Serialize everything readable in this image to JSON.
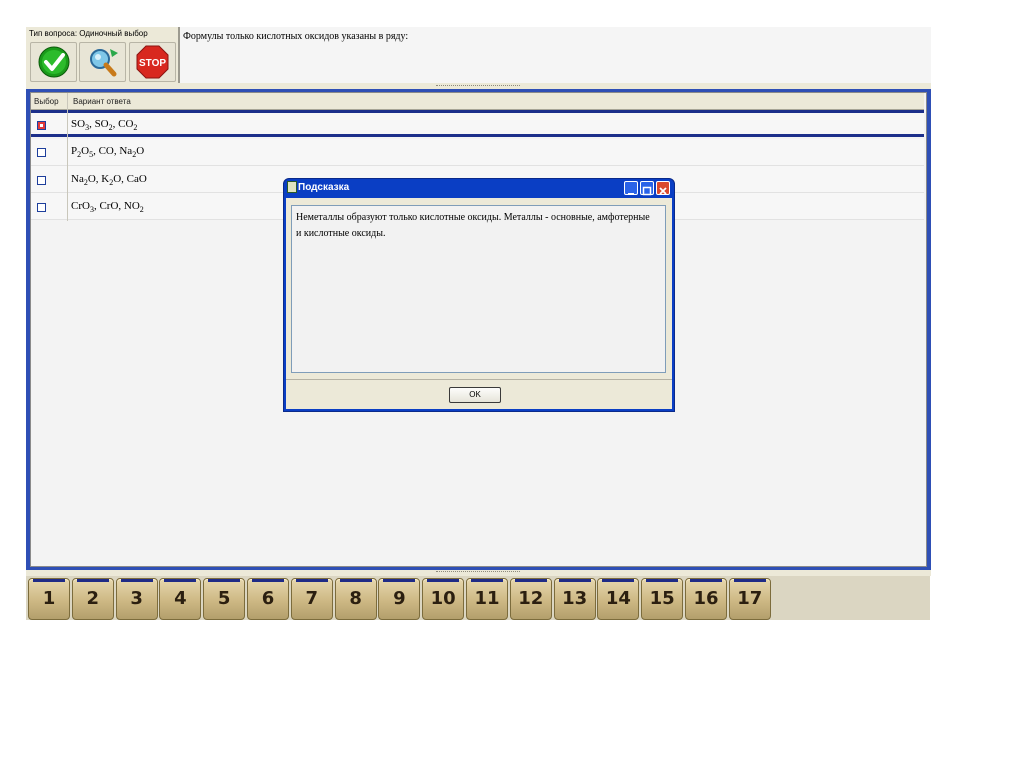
{
  "header": {
    "question_type_label": "Тип вопроса: Одиночный выбор",
    "question_text": "Формулы только кислотных оксидов указаны в ряду:",
    "tools": [
      "confirm-check-icon",
      "hint-magnifier-icon",
      "stop-sign-icon"
    ],
    "stop_label": "STOP"
  },
  "grid": {
    "col_choice": "Выбор",
    "col_answer": "Вариант ответа",
    "rows": [
      {
        "parts": [
          "SO",
          "3",
          ", SO",
          "2",
          ", CO",
          "2"
        ],
        "checked": true
      },
      {
        "parts": [
          "P",
          "2",
          "O",
          "5",
          ", CO, Na",
          "2",
          "O"
        ],
        "checked": false
      },
      {
        "parts": [
          "Na",
          "2",
          "O, K",
          "2",
          "O, CaO"
        ],
        "checked": false
      },
      {
        "parts": [
          "CrO",
          "3",
          ", CrO, NO",
          "2"
        ],
        "checked": false
      }
    ]
  },
  "numbers": [
    "1",
    "2",
    "3",
    "4",
    "5",
    "6",
    "7",
    "8",
    "9",
    "10",
    "11",
    "12",
    "13",
    "14",
    "15",
    "16",
    "17"
  ],
  "dialog": {
    "title": "Подсказка",
    "text": "Неметаллы образуют только кислотные оксиды. Металлы - основные, амфотерные и кислотные оксиды.",
    "ok_label": "OK"
  },
  "colors": {
    "accent_blue": "#0a3ec4",
    "selection": "#1c2f8a",
    "checkbox_checked": "#e23a3a"
  }
}
